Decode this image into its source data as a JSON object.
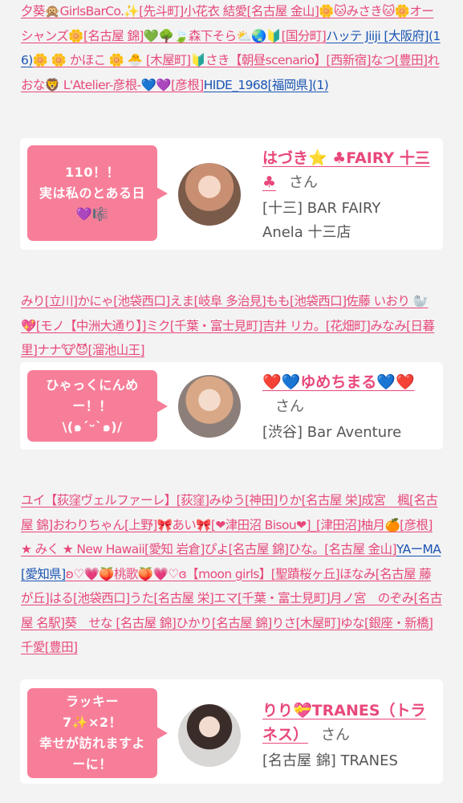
{
  "names_block_1": [
    {
      "text": "夕葵🙊GirlsBarCo.✨[先斗町]"
    },
    {
      "text": "小花衣 結愛[名古屋 金山]🌼🐱みさき🐱🌼オーシャンズ🌼[名古屋 錦]"
    },
    {
      "text": "💚🌳🍃森下そら⛅🌏🔰[国分町]"
    },
    {
      "text": "ハッテ Jiiji [大阪府](16)",
      "color": "blue"
    },
    {
      "text": "🌼 🌼 かほこ 🌼 🐣 [木屋町]"
    },
    {
      "text": "🔰さき【朝昼scenario】[西新宿]"
    },
    {
      "text": "なつ[豊田]"
    },
    {
      "text": "れおな🦁 L'Atelier-彦根-💙💜[彦根]"
    },
    {
      "text": "HIDE_1968[福岡県](1)",
      "color": "blue"
    }
  ],
  "card_1": {
    "message": "110！！\n実は私のとある日💜🎼",
    "cast_name": "はづき⭐ ♣FAIRY 十三♣",
    "suffix": "さん",
    "area": "[十三]",
    "shop": "BAR FAIRY\nAnela 十三店"
  },
  "names_block_2": [
    {
      "text": "みり[立川]"
    },
    {
      "text": "かにゃ[池袋西口]"
    },
    {
      "text": "えま[岐阜 多治見]"
    },
    {
      "text": "もも[池袋西口]"
    },
    {
      "text": "佐藤 いおり 🦭💖[モノ【中洲大通り】]"
    },
    {
      "text": "ミク[千葉・富士見町]"
    },
    {
      "text": "吉井 リカ。[花畑町]"
    },
    {
      "text": "みなみ[日暮里]"
    },
    {
      "text": "ナナ🐮😈[溜池山王]"
    }
  ],
  "card_2": {
    "message": "ひゃっくにんめー！！\n\\(๑´ᵕ`๑)/",
    "cast_name": "❤️💙ゆめちまる💙❤️",
    "suffix": "さん",
    "area": "[渋谷]",
    "shop": "Bar Aventure"
  },
  "names_block_3": [
    {
      "text": "ユイ【荻窪ヴェルファーレ】[荻窪]"
    },
    {
      "text": "みゆう[神田]"
    },
    {
      "text": "りか[名古屋 栄]"
    },
    {
      "text": "成宮　楓[名古屋 錦]"
    },
    {
      "text": "おわりちゃん[上野]"
    },
    {
      "text": "🎀あい🎀[❤津田沼 Bisou❤]_[津田沼]"
    },
    {
      "text": "柚月🍊[彦根]"
    },
    {
      "text": "★ みく ★ New Hawaii[愛知 岩倉]"
    },
    {
      "text": "ぴよ[名古屋 錦]"
    },
    {
      "text": "ひな。[名古屋 金山]"
    },
    {
      "text": "YAーMA[愛知県]",
      "color": "blue"
    },
    {
      "text": "ʚ♡💗🍑桃歌🍑💗♡ɞ【moon girls】[聖蹟桜ヶ丘]"
    },
    {
      "text": "ほなみ[名古屋 藤が丘]"
    },
    {
      "text": "はる[池袋西口]"
    },
    {
      "text": "うた[名古屋 栄]"
    },
    {
      "text": "エマ[千葉・富士見町]"
    },
    {
      "text": "月ノ宮　のぞみ[名古屋 名駅]"
    },
    {
      "text": "葵　せな [名古屋 錦]"
    },
    {
      "text": "ひかり[名古屋 錦]"
    },
    {
      "text": "りさ[木屋町]"
    },
    {
      "text": "ゆな[銀座・新橋]"
    },
    {
      "text": "千愛[豊田]"
    }
  ],
  "card_3": {
    "message": "ラッキー\n7✨×2！\n幸せが訪れますよーに！",
    "cast_name": "りり💝TRANES（トラネス）",
    "suffix": "さん",
    "area": "[名古屋 錦]",
    "shop": "TRANES"
  },
  "colors": {
    "link_pink": "#e8487a",
    "link_blue": "#1a55b4",
    "bubble_pink": "#f77e99",
    "background": "#f3f3f3",
    "card": "#ffffff"
  }
}
